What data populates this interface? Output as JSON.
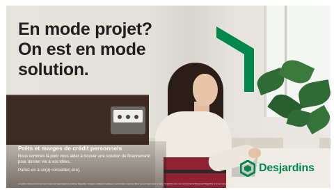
{
  "headline": {
    "line1": "En mode projet?",
    "line2": "On est en mode",
    "line3": "solution."
  },
  "product": {
    "title": "Prêts et marges de crédit personnels",
    "description": "Nous sommes là pour vous aider à trouver une solution de financement pour donner vie à vos idées.",
    "cta": "Parlez-en à un(e) conseiller(-ère)."
  },
  "legal_text": "Les prêts et financements sont sous réserve de l'approbation du crédit par Desjardins. Certaines conditions s'appliquent. Les produits et services offerts peuvent varier selon la caisse. Desjardins est le nom commercial du Mouvement Desjardins et de ses composantes.",
  "brand": {
    "name": "Desjardins",
    "color": "#00874e",
    "logo_icon": "desjardins-hexagon-icon"
  },
  "colors": {
    "accent_green": "#00874e",
    "headline_text": "#1f1f1f"
  }
}
